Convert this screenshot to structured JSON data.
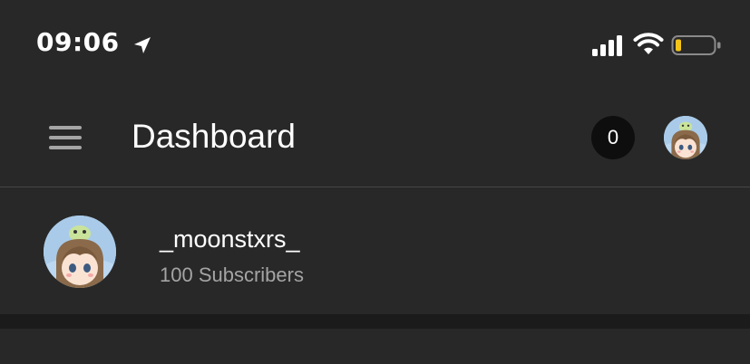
{
  "status_bar": {
    "time": "09:06",
    "icons": [
      "location-arrow-icon",
      "cellular-signal-icon",
      "wifi-icon",
      "battery-low-icon"
    ],
    "battery_level": 0.15,
    "battery_color": "#f5c518"
  },
  "header": {
    "menu_icon": "hamburger-menu-icon",
    "title": "Dashboard",
    "notification_count": "0",
    "avatar_icon": "profile-avatar-icon"
  },
  "channel": {
    "name": "_moonstxrs_",
    "subscribers": "100 Subscribers",
    "avatar_icon": "channel-avatar-icon"
  },
  "colors": {
    "background": "#282828",
    "divider": "#464646",
    "section_gap": "#1b1b1b",
    "subtext": "#a4a4a4",
    "badge": "#0e0e0e"
  }
}
